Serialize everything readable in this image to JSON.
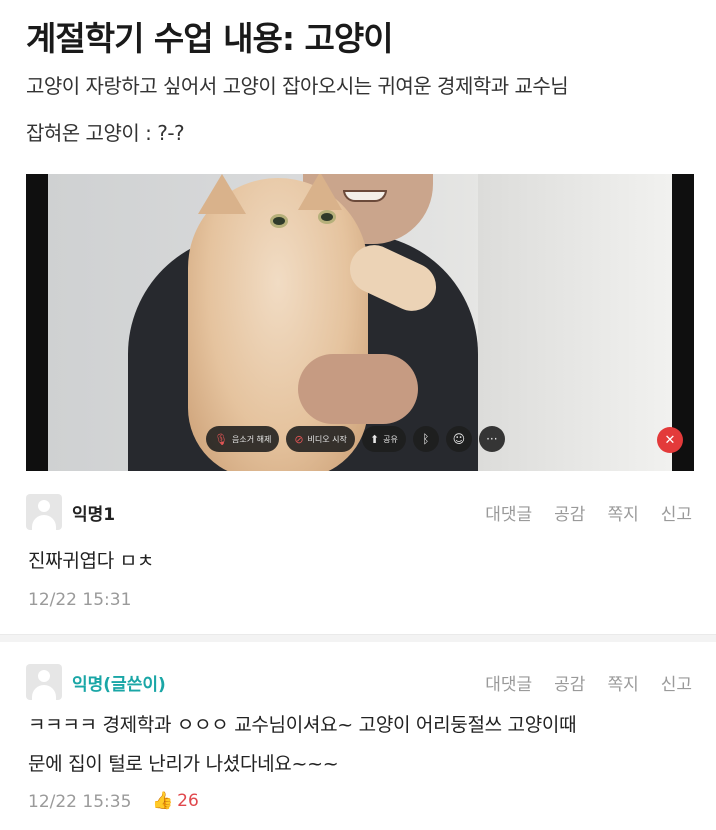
{
  "post": {
    "title": "계절학기 수업 내용: 고양이",
    "line1": "고양이 자랑하고 싶어서 고양이 잡아오시는 귀여운 경제학과 교수님",
    "line2": "잡혀온 고양이 : ?-?"
  },
  "video_call": {
    "controls": [
      {
        "label": "음소거 해제",
        "icon": "mic-off-icon"
      },
      {
        "label": "비디오 시작",
        "icon": "video-off-icon"
      },
      {
        "label": "공유",
        "icon": "share-icon"
      }
    ],
    "bluetooth_icon": "ᛒ",
    "emoji_icon": "☺",
    "more_icon": "···",
    "end_icon": "✕",
    "colors": {
      "end_call": "#e33a3a"
    }
  },
  "comments": [
    {
      "author": "익명1",
      "body": "진짜귀엽다 ㅁㅊ",
      "time": "12/22 15:31",
      "actions": [
        "대댓글",
        "공감",
        "쪽지",
        "신고"
      ]
    },
    {
      "author": "익명(글쓴이)",
      "body_line1": "ㅋㅋㅋㅋ 경제학과 ㅇㅇㅇ 교수님이셔요~ 고양이 어리둥절쓰 고양이때",
      "body_line2": "문에 집이 털로 난리가 나셨다네요~~~",
      "time": "12/22 15:35",
      "likes": "26",
      "actions": [
        "대댓글",
        "공감",
        "쪽지",
        "신고"
      ],
      "colors": {
        "author": "#1aa6a6",
        "likes": "#e0474c"
      }
    }
  ]
}
